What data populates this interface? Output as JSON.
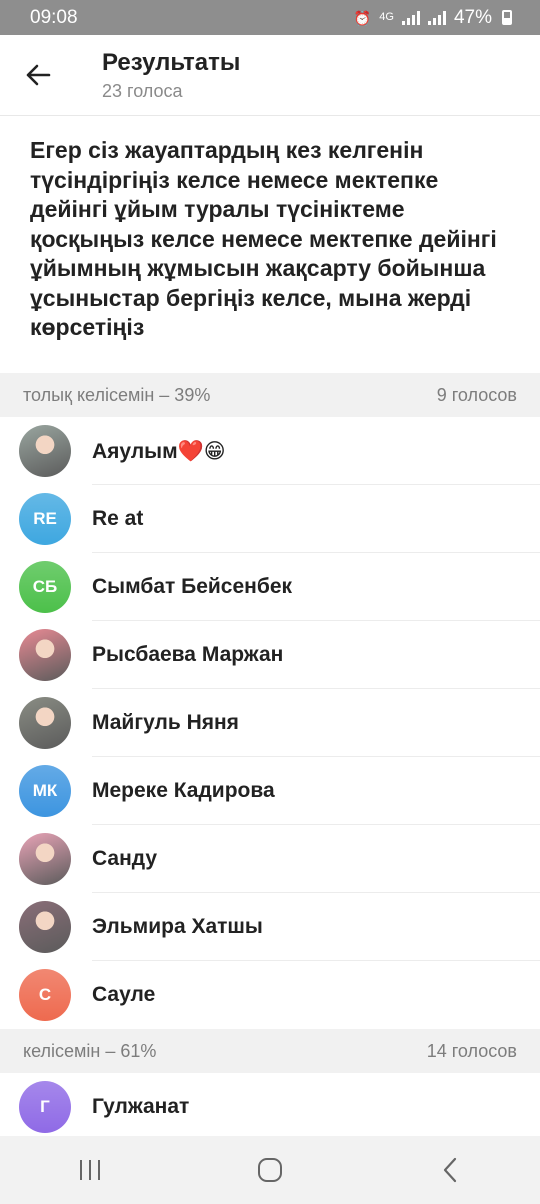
{
  "status_bar": {
    "time": "09:08",
    "network": "4G",
    "battery": "47%"
  },
  "header": {
    "title": "Результаты",
    "subtitle": "23 голоса",
    "back_icon": "arrow-left-icon"
  },
  "question": "Егер сіз жауаптардың кез келгенін түсіндіргіңіз келсе немесе мектепке дейінгі ұйым туралы түсініктеме қосқыңыз келсе немесе мектепке дейінгі ұйымның жұмысын жақсарту бойынша ұсыныстар бергіңіз келсе, мына жерді көрсетіңіз",
  "sections": [
    {
      "option": "толық келісемін – 39%",
      "count": "9 голосов",
      "voters": [
        {
          "name": "Аяулым❤️😁",
          "initials": "",
          "color": "#9aa6a0"
        },
        {
          "name": "Re at",
          "initials": "RE",
          "color": "#3ea7e0"
        },
        {
          "name": "Сымбат Бейсенбек",
          "initials": "СБ",
          "color": "#4cc04a"
        },
        {
          "name": "Рысбаева Маржан",
          "initials": "",
          "color": "#e88a94"
        },
        {
          "name": "Майгуль Няня",
          "initials": "",
          "color": "#8a8d84"
        },
        {
          "name": "Мереке Кадирова",
          "initials": "МК",
          "color": "#3d95e0"
        },
        {
          "name": "Санду",
          "initials": "",
          "color": "#e9a4b7"
        },
        {
          "name": "Эльмира Хатшы",
          "initials": "",
          "color": "#8a6e78"
        },
        {
          "name": "Сауле",
          "initials": "С",
          "color": "#ee6a4f"
        }
      ]
    },
    {
      "option": "келісемін – 61%",
      "count": "14 голосов",
      "voters": [
        {
          "name": "Гулжанат",
          "initials": "Г",
          "color": "#8f6ae6"
        }
      ]
    }
  ]
}
